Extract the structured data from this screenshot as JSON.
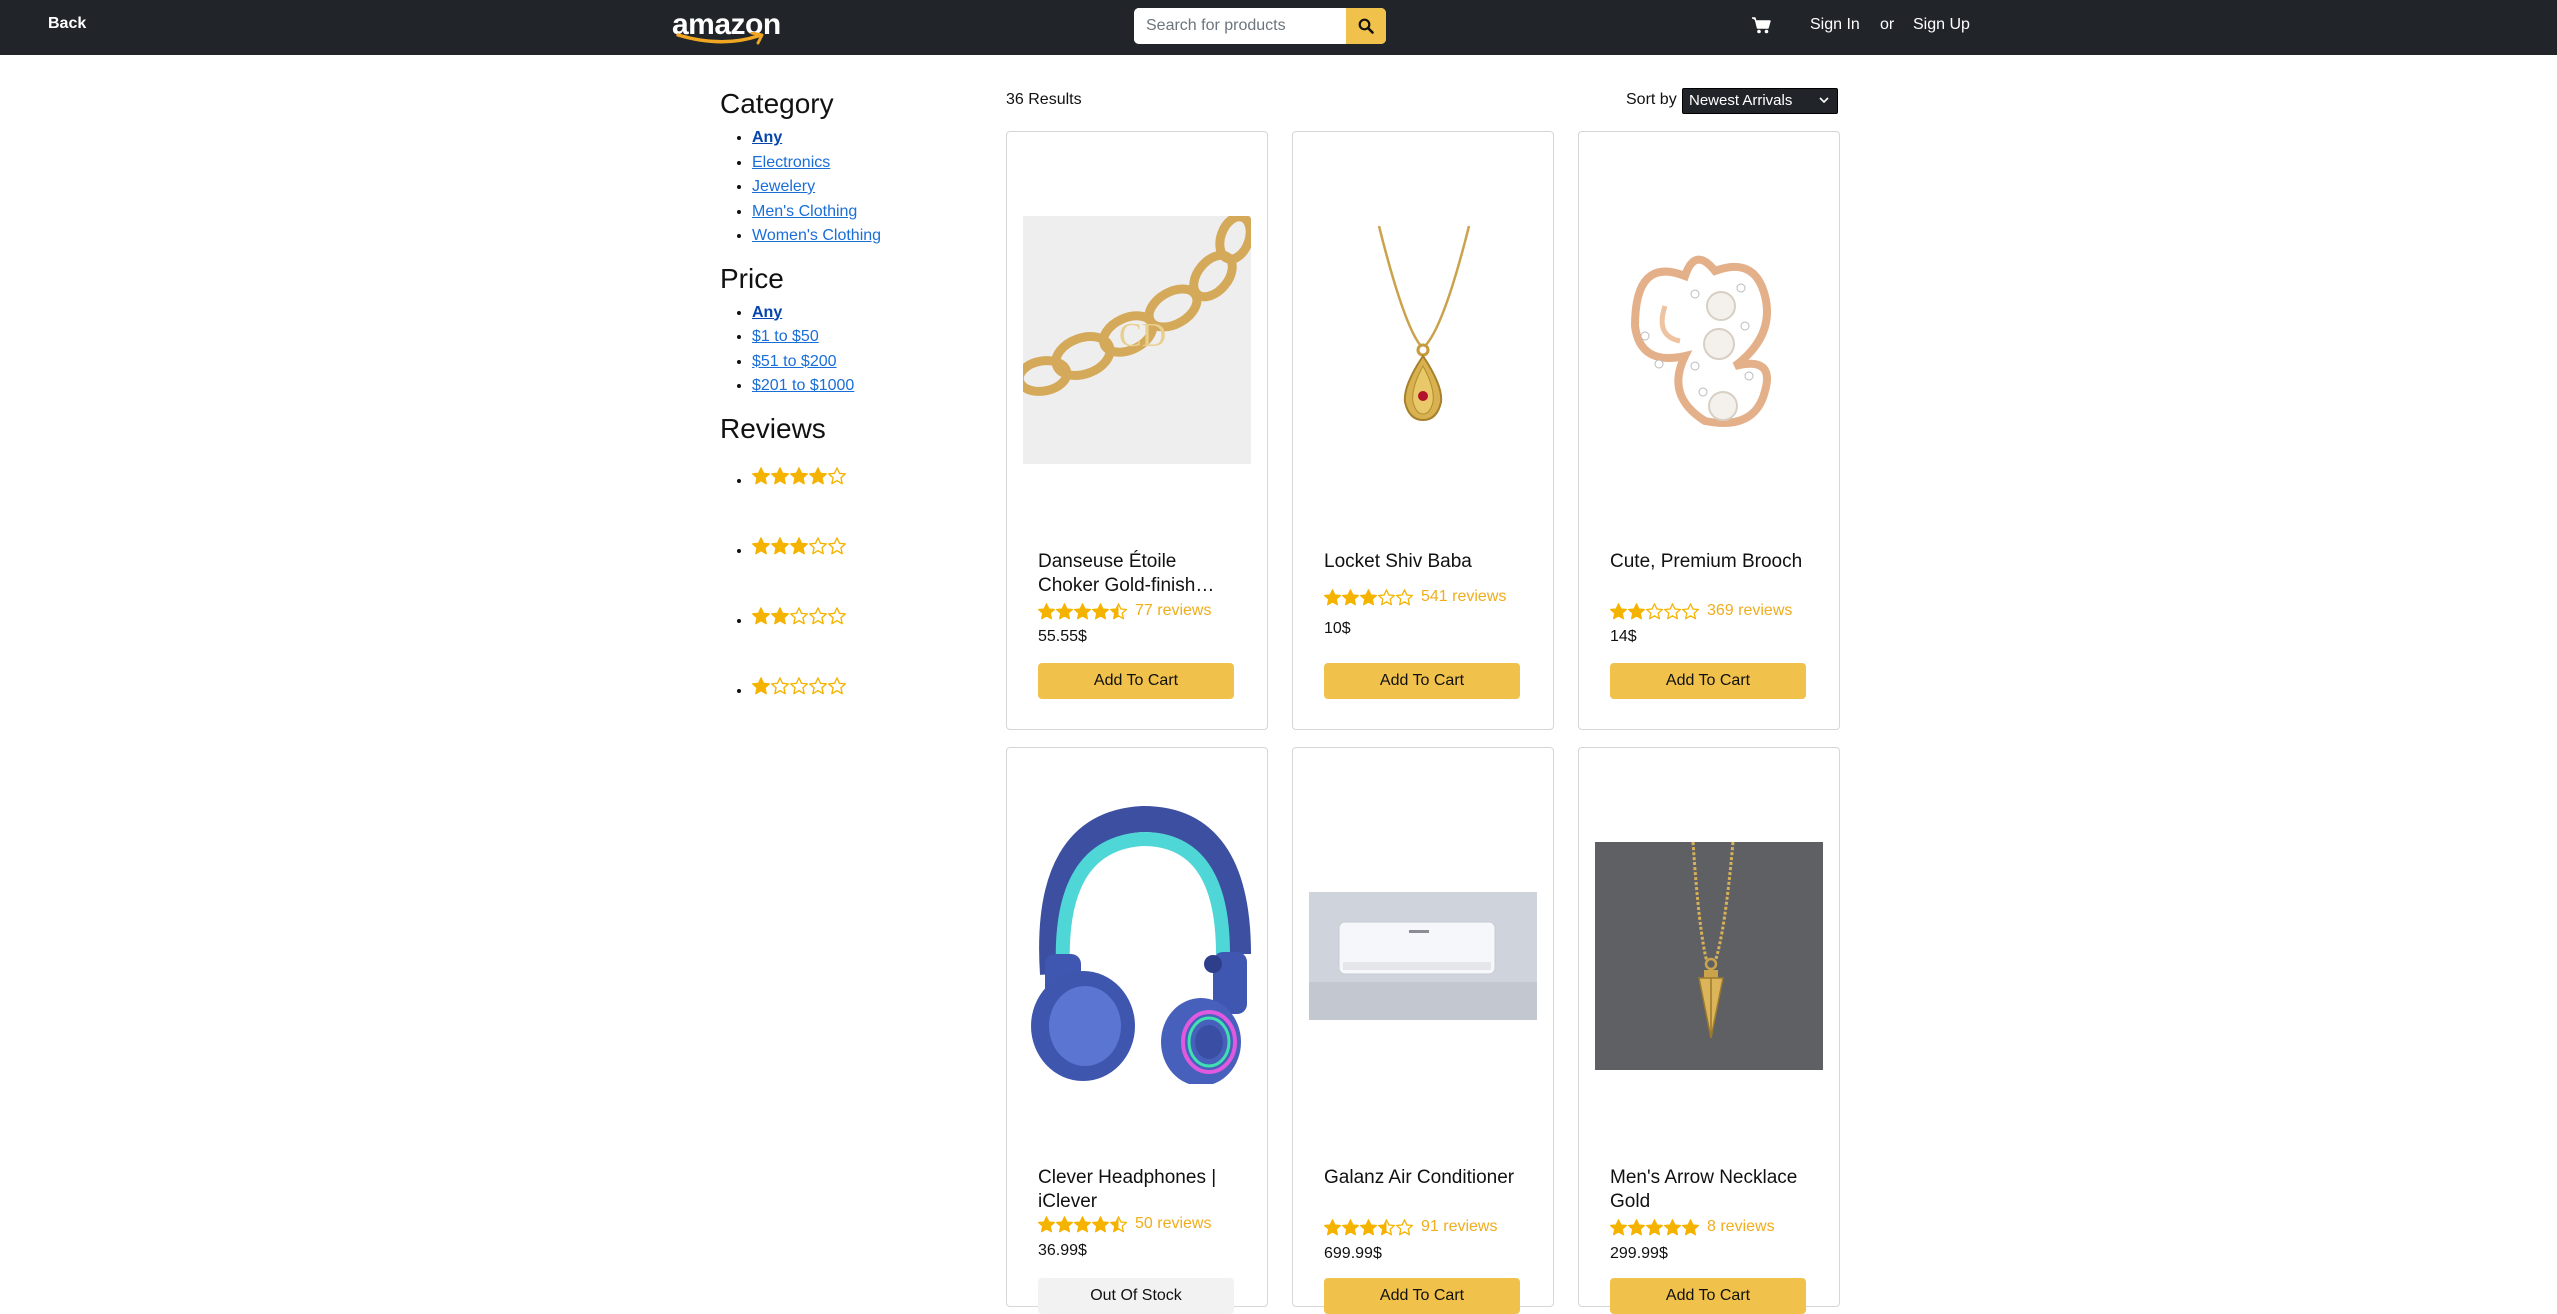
{
  "header": {
    "back_label": "Back",
    "logo_text": "amazon",
    "search_placeholder": "Search for products",
    "signin_label": "Sign In",
    "or_label": "or",
    "signup_label": "Sign Up"
  },
  "sidebar": {
    "category_title": "Category",
    "category_items": [
      "Any",
      "Electronics",
      "Jewelery",
      "Men's Clothing",
      "Women's Clothing"
    ],
    "price_title": "Price",
    "price_items": [
      "Any",
      "$1 to $50",
      "$51 to $200",
      "$201 to $1000"
    ],
    "reviews_title": "Reviews",
    "review_filters": [
      4,
      3,
      2,
      1
    ]
  },
  "main": {
    "results_text": "36 Results",
    "sort_label": "Sort by",
    "sort_value": "Newest Arrivals"
  },
  "colors": {
    "header_bg": "#212529",
    "accent": "#f0c14b",
    "star": "#f5b301",
    "link": "#1a6ed8"
  },
  "products": [
    {
      "name": "Danseuse Étoile Choker Gold-finish…",
      "rating": 4.5,
      "reviews": "77 reviews",
      "price": "55.55$",
      "button": "Add To Cart",
      "image_icon": "gold-chain-choker-image"
    },
    {
      "name": "Locket Shiv Baba",
      "rating": 3,
      "reviews": "541 reviews",
      "price": "10$",
      "button": "Add To Cart",
      "image_icon": "gold-locket-necklace-image"
    },
    {
      "name": "Cute, Premium Brooch",
      "rating": 2,
      "reviews": "369 reviews",
      "price": "14$",
      "button": "Add To Cart",
      "image_icon": "pearl-brooch-image"
    },
    {
      "name": "Clever Headphones | iClever",
      "rating": 4.5,
      "reviews": "50 reviews",
      "price": "36.99$",
      "button": "Out Of Stock",
      "image_icon": "headphones-image"
    },
    {
      "name": "Galanz Air Conditioner",
      "rating": 3.5,
      "reviews": "91 reviews",
      "price": "699.99$",
      "button": "Add To Cart",
      "image_icon": "air-conditioner-image"
    },
    {
      "name": "Men's Arrow Necklace Gold",
      "rating": 5,
      "reviews": "8 reviews",
      "price": "299.99$",
      "button": "Add To Cart",
      "image_icon": "arrow-necklace-image"
    }
  ]
}
